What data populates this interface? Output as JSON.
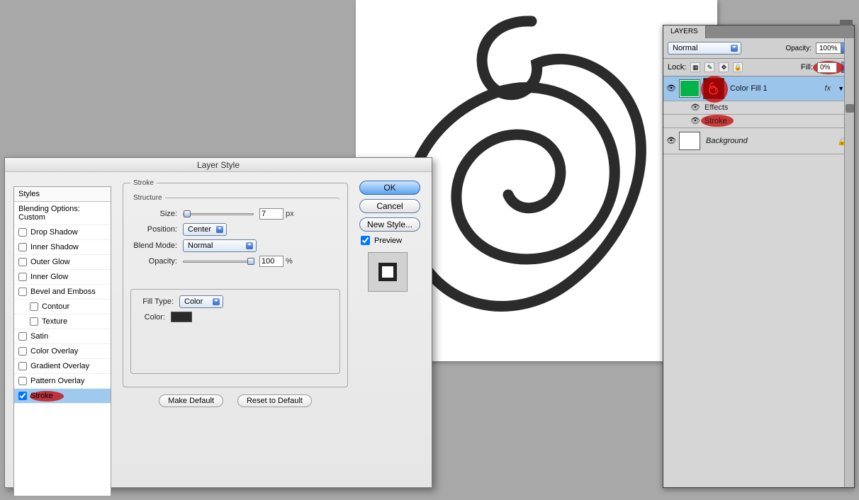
{
  "dialog": {
    "title": "Layer Style",
    "styles_header": "Styles",
    "blending_label": "Blending Options: Custom",
    "items": [
      {
        "label": "Drop Shadow",
        "checked": false
      },
      {
        "label": "Inner Shadow",
        "checked": false
      },
      {
        "label": "Outer Glow",
        "checked": false
      },
      {
        "label": "Inner Glow",
        "checked": false
      },
      {
        "label": "Bevel and Emboss",
        "checked": false
      },
      {
        "label": "Contour",
        "checked": false,
        "indent": true
      },
      {
        "label": "Texture",
        "checked": false,
        "indent": true
      },
      {
        "label": "Satin",
        "checked": false
      },
      {
        "label": "Color Overlay",
        "checked": false
      },
      {
        "label": "Gradient Overlay",
        "checked": false
      },
      {
        "label": "Pattern Overlay",
        "checked": false
      },
      {
        "label": "Stroke",
        "checked": true,
        "selected": true
      }
    ],
    "stroke": {
      "section_label": "Stroke",
      "structure_label": "Structure",
      "size_label": "Size:",
      "size_value": "7",
      "size_unit": "px",
      "position_label": "Position:",
      "position_value": "Center",
      "blend_label": "Blend Mode:",
      "blend_value": "Normal",
      "opacity_label": "Opacity:",
      "opacity_value": "100",
      "opacity_unit": "%",
      "filltype_label": "Fill Type:",
      "filltype_value": "Color",
      "color_label": "Color:",
      "color_value": "#2a2a2a",
      "make_default": "Make Default",
      "reset_default": "Reset to Default"
    },
    "buttons": {
      "ok": "OK",
      "cancel": "Cancel",
      "newstyle": "New Style...",
      "preview": "Preview"
    }
  },
  "layers_panel": {
    "tab": "LAYERS",
    "blend_mode": "Normal",
    "opacity_label": "Opacity:",
    "opacity_value": "100%",
    "lock_label": "Lock:",
    "fill_label": "Fill:",
    "fill_value": "0%",
    "layers": [
      {
        "name": "Color Fill 1",
        "fx": "fx",
        "selected": true,
        "thumb": "#00b44a"
      },
      {
        "name": "Background",
        "locked": true,
        "thumb": "#ffffff"
      }
    ],
    "effects_label": "Effects",
    "effect_stroke": "Stroke"
  }
}
